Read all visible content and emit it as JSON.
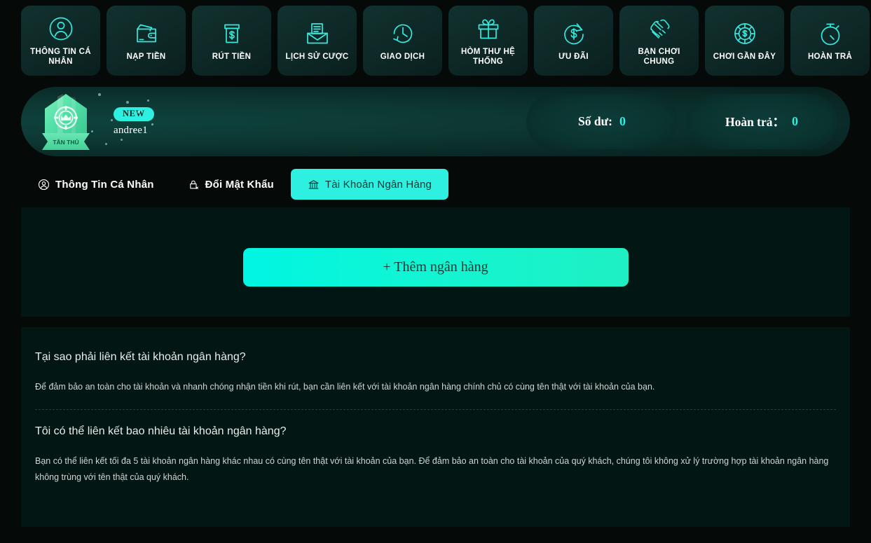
{
  "theme": {
    "accent": "#2ef0e0",
    "accent_deep": "#00f5e2",
    "panel_bg": "#021614",
    "page_bg": "#050908",
    "text": "#ffffff"
  },
  "topnav": {
    "items": [
      {
        "label": "THÔNG TIN CÁ NHÂN",
        "icon": "user-circle-icon"
      },
      {
        "label": "NẠP TIỀN",
        "icon": "wallet-icon"
      },
      {
        "label": "RÚT TIỀN",
        "icon": "atm-cash-icon"
      },
      {
        "label": "LỊCH SỬ CƯỢC",
        "icon": "envelope-document-icon"
      },
      {
        "label": "GIAO DỊCH",
        "icon": "clock-history-icon"
      },
      {
        "label": "HÒM THƯ HỆ THỐNG",
        "icon": "gift-icon"
      },
      {
        "label": "ƯU ĐÃI",
        "icon": "dollar-refresh-icon"
      },
      {
        "label": "BẠN CHƠI CHUNG",
        "icon": "handshake-icon"
      },
      {
        "label": "CHƠI GẦN ĐÂY",
        "icon": "poker-chip-dollar-icon"
      },
      {
        "label": "HOÀN TRẢ",
        "icon": "stopwatch-icon"
      }
    ]
  },
  "profile": {
    "rank_badge_icon": "rank-shield-icon",
    "rank_ribbon_label": "TÂN THỦ",
    "new_badge": "NEW",
    "username": "andree1",
    "balances": [
      {
        "label": "Số dư:",
        "value": "0"
      },
      {
        "label": "Hoàn trả：",
        "value": "0"
      }
    ]
  },
  "tabs": [
    {
      "label": "Thông Tin Cá Nhân",
      "icon": "user-circle-icon",
      "active": false
    },
    {
      "label": "Đổi Mật Khẩu",
      "icon": "lock-x-icon",
      "active": false
    },
    {
      "label": "Tài Khoản Ngân Hàng",
      "icon": "bank-building-icon",
      "active": true
    }
  ],
  "bank_panel": {
    "add_button_label": "+ Thêm ngân hàng"
  },
  "faq": [
    {
      "question": "Tại sao phải liên kết tài khoản ngân hàng?",
      "answer": "Để đảm bảo an toàn cho tài khoản và nhanh chóng nhận tiền khi rút, bạn cần liên kết với tài khoản ngân hàng chính chủ có cùng tên thật với tài khoản của bạn."
    },
    {
      "question": "Tôi có thể liên kết bao nhiêu tài khoản ngân hàng?",
      "answer": "Bạn có thể liên kết tối đa 5 tài khoản ngân hàng khác nhau có cùng tên thật với tài khoản của bạn. Để đảm bảo an toàn cho tài khoản của quý khách, chúng tôi không xử lý trường hợp tài khoản ngân hàng không trùng với tên thật của quý khách."
    }
  ]
}
